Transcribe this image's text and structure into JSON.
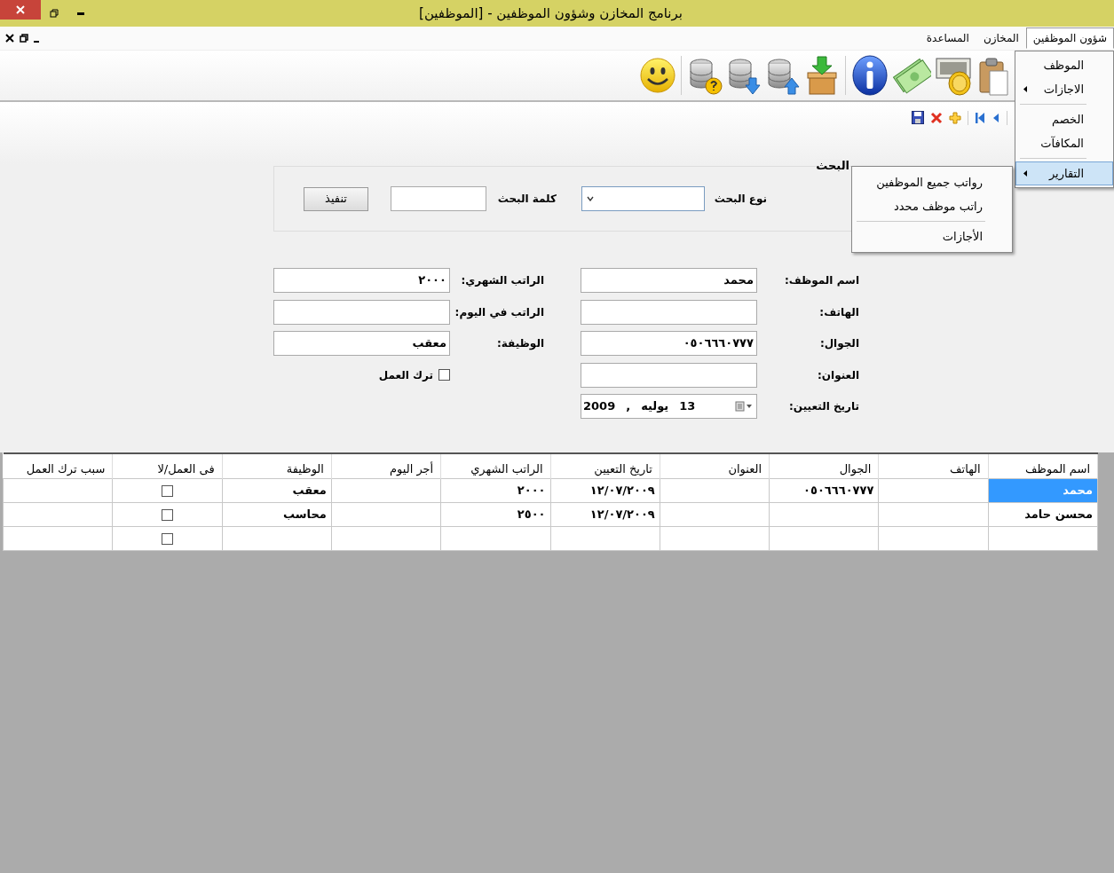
{
  "window": {
    "title": "برنامج المخازن وشؤون الموظفين - [الموظفين]"
  },
  "menu": [
    {
      "label": "شؤون الموظفين",
      "selected": true
    },
    {
      "label": "المخازن",
      "selected": false
    },
    {
      "label": "المساعدة",
      "selected": false
    }
  ],
  "dropdown": [
    {
      "label": "الموظف",
      "has_submenu": false,
      "selected": false
    },
    {
      "label": "الاجازات",
      "has_submenu": true,
      "selected": false
    },
    {
      "kind": "separator"
    },
    {
      "label": "الخصم",
      "has_submenu": false,
      "selected": false
    },
    {
      "label": "المكافآت",
      "has_submenu": false,
      "selected": false
    },
    {
      "kind": "separator"
    },
    {
      "label": "التقارير",
      "has_submenu": true,
      "selected": true
    }
  ],
  "submenu": [
    {
      "label": "رواتب جميع الموظفين"
    },
    {
      "label": "راتب موظف محدد"
    },
    {
      "kind": "separator"
    },
    {
      "label": "الأجازات"
    }
  ],
  "search": {
    "title": "البحث",
    "type_label": "نوع البحث",
    "word_label": "كلمة البحث",
    "button": "تنفيذ"
  },
  "employee_form": {
    "right": [
      {
        "kind": "text",
        "label": "اسم الموظف:",
        "value": "محمد"
      },
      {
        "kind": "text",
        "label": "الهاتف:"
      },
      {
        "kind": "text",
        "label": "الجوال:",
        "value": "٠٥٠٦٦٦٠٧٧٧"
      },
      {
        "kind": "text",
        "label": "العنوان:"
      },
      {
        "kind": "date",
        "label": "تاريخ التعيين:",
        "day": "13",
        "month": "يوليه",
        "separator": ",",
        "year": "2009"
      }
    ],
    "left": [
      {
        "kind": "text",
        "label": "الراتب الشهري:",
        "value": "٢٠٠٠"
      },
      {
        "kind": "text",
        "label": "الراتب في اليوم:"
      },
      {
        "kind": "text",
        "label": "الوظيفة:",
        "value": "معقب"
      },
      {
        "kind": "checkbox",
        "label": "ترك العمل",
        "checked": false
      }
    ]
  },
  "table": {
    "columns": [
      {
        "kind": "text",
        "label": "اسم الموظف"
      },
      {
        "kind": "text",
        "label": "الهاتف"
      },
      {
        "kind": "text",
        "label": "الجوال"
      },
      {
        "kind": "text",
        "label": "العنوان"
      },
      {
        "kind": "text",
        "label": "تاريخ التعيين"
      },
      {
        "kind": "text",
        "label": "الراتب الشهري"
      },
      {
        "kind": "text",
        "label": "أجر اليوم"
      },
      {
        "kind": "text",
        "label": "الوظيفة"
      },
      {
        "kind": "checkbox",
        "label": "فى العمل/لا"
      },
      {
        "kind": "text",
        "label": "سبب ترك العمل"
      }
    ],
    "rows": [
      {
        "selected": true,
        "cells": [
          "محمد",
          null,
          "٠٥٠٦٦٦٠٧٧٧",
          null,
          "١٢/٠٧/٢٠٠٩",
          "٢٠٠٠",
          null,
          "معقب",
          false,
          null
        ]
      },
      {
        "selected": false,
        "cells": [
          "محسن حامد",
          null,
          null,
          null,
          "١٢/٠٧/٢٠٠٩",
          "٢٥٠٠",
          null,
          "محاسب",
          false,
          null
        ]
      },
      {
        "selected": false,
        "cells": [
          null,
          null,
          null,
          null,
          null,
          null,
          null,
          null,
          false,
          null
        ]
      }
    ]
  }
}
